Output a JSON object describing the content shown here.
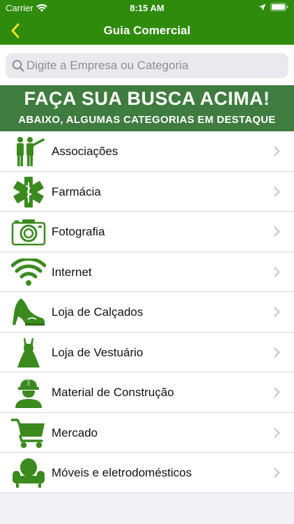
{
  "status_bar": {
    "carrier": "Carrier",
    "time": "8:15 AM"
  },
  "nav": {
    "title": "Guia Comercial",
    "back_icon": "chevron-left-icon"
  },
  "search": {
    "value": "",
    "placeholder": "Digite a Empresa ou Categoria"
  },
  "banner": {
    "line1": "FAÇA SUA BUSCA ACIMA!",
    "line2": "ABAIXO, ALGUMAS CATEGORIAS EM DESTAQUE"
  },
  "colors": {
    "bar_green": "#2e8b0c",
    "banner_green": "#3f7c3f",
    "icon_green": "#3a8a1e",
    "back_yellow": "#f2e21b"
  },
  "categories": [
    {
      "label": "Associações",
      "icon": "people-pointing-icon"
    },
    {
      "label": "Farmácia",
      "icon": "medical-star-icon"
    },
    {
      "label": "Fotografia",
      "icon": "camera-icon"
    },
    {
      "label": "Internet",
      "icon": "wifi-icon"
    },
    {
      "label": "Loja de Calçados",
      "icon": "shoe-icon"
    },
    {
      "label": "Loja de Vestuário",
      "icon": "dress-icon"
    },
    {
      "label": "Material de Construção",
      "icon": "construction-worker-icon"
    },
    {
      "label": "Mercado",
      "icon": "shopping-cart-icon"
    },
    {
      "label": "Móveis e eletrodomésticos",
      "icon": "armchair-icon"
    }
  ]
}
